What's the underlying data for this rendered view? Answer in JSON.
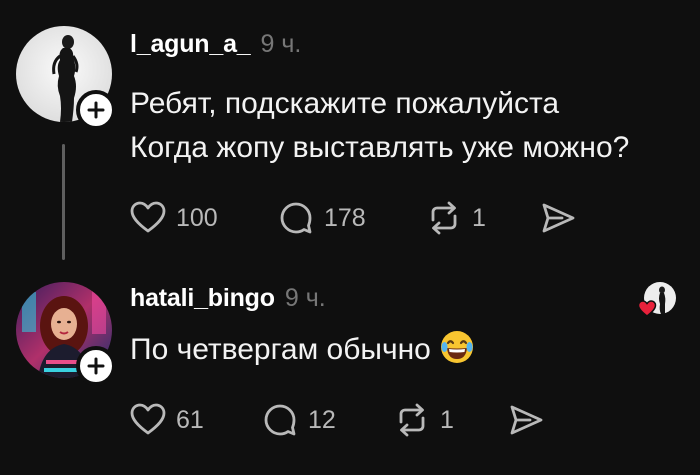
{
  "posts": [
    {
      "username": "l_agun_a_",
      "time": "9 ч.",
      "lines": [
        "Ребят, подскажите пожалуйста",
        "Когда жопу выставлять уже можно?"
      ],
      "likes": "100",
      "comments": "178",
      "reposts": "1"
    },
    {
      "username": "hatali_bingo",
      "time": "9 ч.",
      "lines": [
        "По четвергам обычно"
      ],
      "emoji": "laughing-face",
      "likes": "61",
      "comments": "12",
      "reposts": "1"
    }
  ],
  "colors": {
    "background": "#0f0f0f",
    "text": "#f3f3f3",
    "muted": "#777777",
    "icon": "#b9b9b9",
    "heart": "#e8213b"
  },
  "icons": [
    "heart-icon",
    "comment-icon",
    "repost-icon",
    "share-icon",
    "plus-icon"
  ]
}
